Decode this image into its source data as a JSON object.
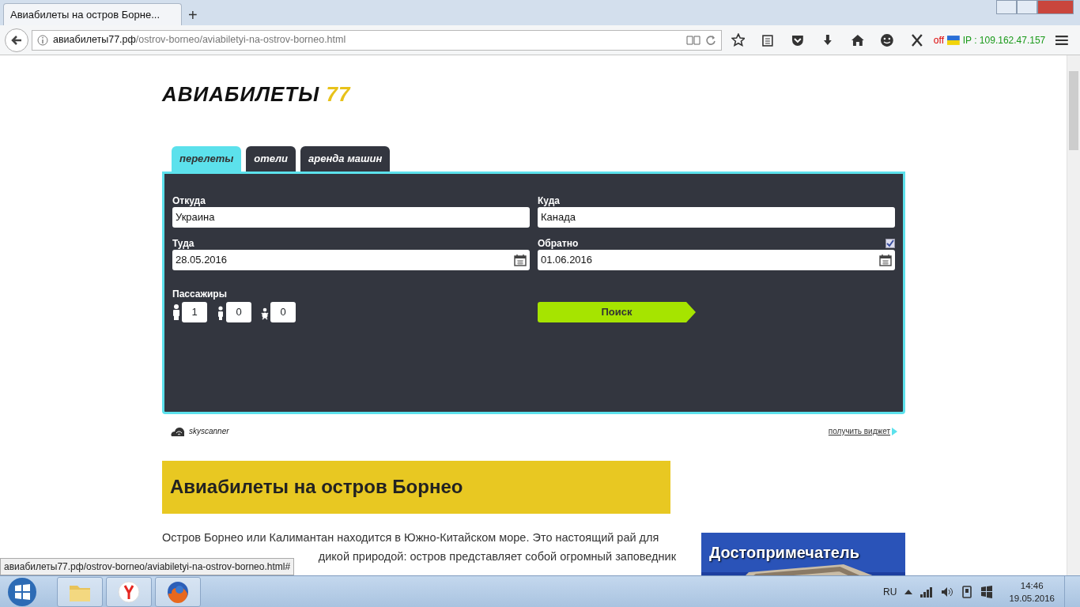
{
  "browser": {
    "tab_title": "Авиабилеты на остров Борне...",
    "new_tab": "+",
    "url_host": "авиабилеты77.рф",
    "url_path": "/ostrov-borneo/aviabiletyi-na-ostrov-borneo.html",
    "addon_state": "off",
    "ip_text": "IP : 109.162.47.157"
  },
  "logo": {
    "text": "АВИАБИЛЕТЫ",
    "number": "77"
  },
  "widget": {
    "tabs": [
      {
        "label": "перелеты",
        "selected": true
      },
      {
        "label": "отели",
        "selected": false
      },
      {
        "label": "аренда машин",
        "selected": false
      }
    ],
    "fields": [
      {
        "label": "Откуда",
        "value": "Украина",
        "kind": "text"
      },
      {
        "label": "Куда",
        "value": "Канада",
        "kind": "text"
      },
      {
        "label": "Туда",
        "value": "28.05.2016",
        "kind": "date"
      },
      {
        "label": "Обратно",
        "value": "01.06.2016",
        "kind": "date",
        "checked": true
      }
    ],
    "passengers_label": "Пассажиры",
    "passengers": [
      {
        "kind": "adult",
        "value": "1"
      },
      {
        "kind": "child",
        "value": "0"
      },
      {
        "kind": "infant",
        "value": "0"
      }
    ],
    "search_button": "Поиск",
    "provider": "skyscanner",
    "get_widget": "получить виджет"
  },
  "article": {
    "heading": "Авиабилеты на остров Борнео",
    "lines": [
      {
        "kind": "full",
        "text": "Остров Борнео или Калимантан находится в Южно-Китайском море. Это настоящий рай для"
      },
      {
        "kind": "partial",
        "text": "дикой природой: остров представляет собой огромный заповедник"
      }
    ]
  },
  "ad": {
    "title": "Достопримечатель"
  },
  "status_url": "авиабилеты77.рф/ostrov-borneo/aviabiletyi-na-ostrov-borneo.html#",
  "taskbar": {
    "language": "RU",
    "time": "14:46",
    "date": "19.05.2016"
  }
}
